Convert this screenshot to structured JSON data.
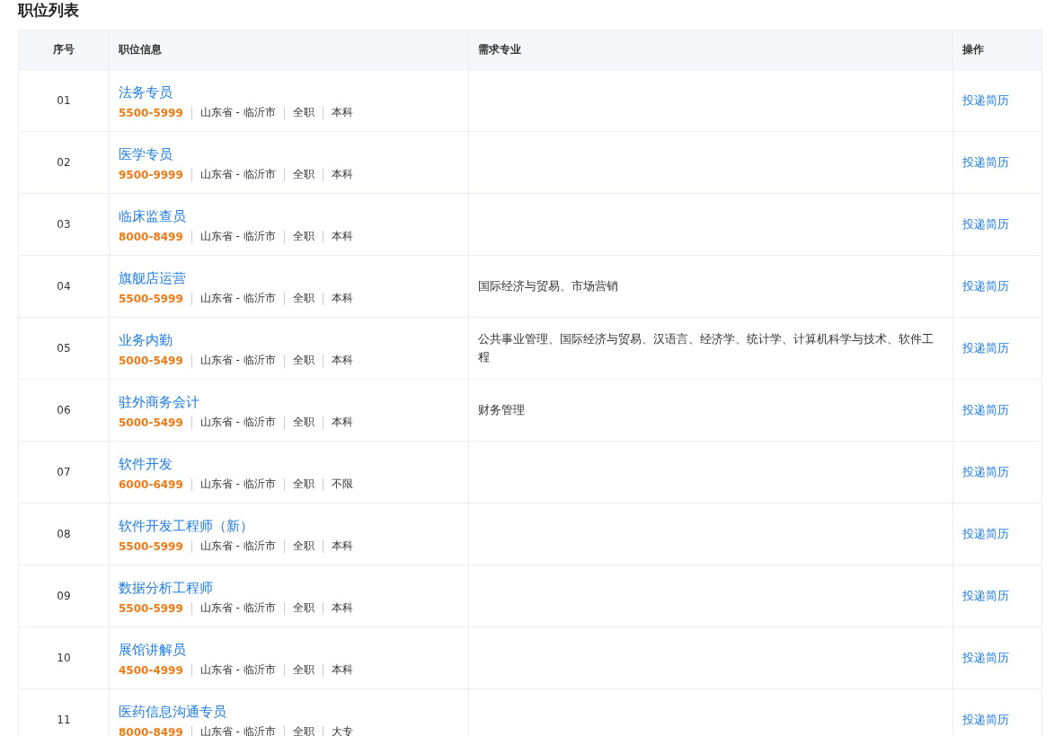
{
  "title": "职位列表",
  "table": {
    "columns": [
      "序号",
      "职位信息",
      "需求专业",
      "操作"
    ],
    "rows": [
      {
        "index": "01",
        "position": "法务专员",
        "salary": "5500-5999",
        "location": "山东省 - 临沂市",
        "type": "全职",
        "education": "本科",
        "majors": "",
        "action": "投递简历"
      },
      {
        "index": "02",
        "position": "医学专员",
        "salary": "9500-9999",
        "location": "山东省 - 临沂市",
        "type": "全职",
        "education": "本科",
        "majors": "",
        "action": "投递简历"
      },
      {
        "index": "03",
        "position": "临床监查员",
        "salary": "8000-8499",
        "location": "山东省 - 临沂市",
        "type": "全职",
        "education": "本科",
        "majors": "",
        "action": "投递简历"
      },
      {
        "index": "04",
        "position": "旗舰店运营",
        "salary": "5500-5999",
        "location": "山东省 - 临沂市",
        "type": "全职",
        "education": "本科",
        "majors": "国际经济与贸易、市场营销",
        "action": "投递简历"
      },
      {
        "index": "05",
        "position": "业务内勤",
        "salary": "5000-5499",
        "location": "山东省 - 临沂市",
        "type": "全职",
        "education": "本科",
        "majors": "公共事业管理、国际经济与贸易、汉语言、经济学、统计学、计算机科学与技术、软件工程",
        "action": "投递简历"
      },
      {
        "index": "06",
        "position": "驻外商务会计",
        "salary": "5000-5499",
        "location": "山东省 - 临沂市",
        "type": "全职",
        "education": "本科",
        "majors": "财务管理",
        "action": "投递简历"
      },
      {
        "index": "07",
        "position": "软件开发",
        "salary": "6000-6499",
        "location": "山东省 - 临沂市",
        "type": "全职",
        "education": "不限",
        "majors": "",
        "action": "投递简历"
      },
      {
        "index": "08",
        "position": "软件开发工程师（新）",
        "salary": "5500-5999",
        "location": "山东省 - 临沂市",
        "type": "全职",
        "education": "本科",
        "majors": "",
        "action": "投递简历"
      },
      {
        "index": "09",
        "position": "数据分析工程师",
        "salary": "5500-5999",
        "location": "山东省 - 临沂市",
        "type": "全职",
        "education": "本科",
        "majors": "",
        "action": "投递简历"
      },
      {
        "index": "10",
        "position": "展馆讲解员",
        "salary": "4500-4999",
        "location": "山东省 - 临沂市",
        "type": "全职",
        "education": "本科",
        "majors": "",
        "action": "投递简历"
      },
      {
        "index": "11",
        "position": "医药信息沟通专员",
        "salary": "8000-8499",
        "location": "山东省 - 临沂市",
        "type": "全职",
        "education": "大专",
        "majors": "",
        "action": "投递简历"
      }
    ]
  }
}
